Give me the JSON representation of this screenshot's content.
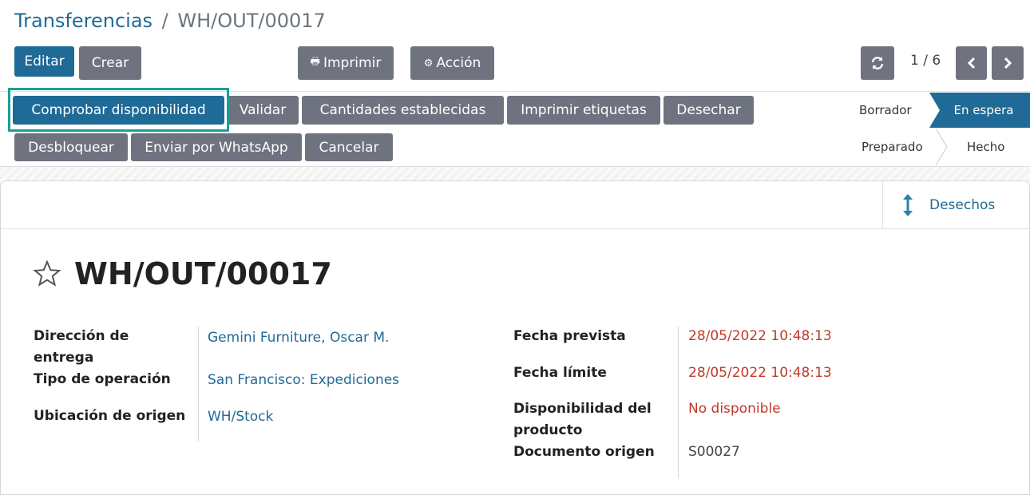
{
  "breadcrumb": {
    "parent": "Transferencias",
    "separator": "/",
    "current": "WH/OUT/00017"
  },
  "toolbar": {
    "edit_label": "Editar",
    "create_label": "Crear",
    "print_label": "Imprimir",
    "action_label": "Acción",
    "pager": "1 / 6"
  },
  "actions": {
    "check_availability": "Comprobar disponibilidad",
    "validate": "Validar",
    "set_quantities": "Cantidades establecidas",
    "print_labels": "Imprimir etiquetas",
    "scrap": "Desechar",
    "unlock": "Desbloquear",
    "whatsapp": "Enviar por WhatsApp",
    "cancel": "Cancelar"
  },
  "statusbar": {
    "draft": "Borrador",
    "waiting": "En espera",
    "ready": "Preparado",
    "done": "Hecho",
    "active": "En espera"
  },
  "smart_button": {
    "scraps_label": "Desechos"
  },
  "record": {
    "name": "WH/OUT/00017",
    "fields_left": [
      {
        "label": "Dirección de entrega",
        "value": "Gemini Furniture, Oscar M."
      },
      {
        "label": "Tipo de operación",
        "value": "San Francisco: Expediciones"
      },
      {
        "label": "Ubicación de origen",
        "value": "WH/Stock"
      }
    ],
    "fields_right": [
      {
        "label": "Fecha prevista",
        "value": "28/05/2022 10:48:13"
      },
      {
        "label": "Fecha límite",
        "value": "28/05/2022 10:48:13"
      },
      {
        "label": "Disponibilidad del producto",
        "value": "No disponible"
      },
      {
        "label": "Documento origen",
        "value": "S00027"
      }
    ]
  },
  "colors": {
    "primary": "#1f6a96",
    "secondary": "#6f7380",
    "highlight": "#16a09a",
    "danger": "#c0392b"
  },
  "icons": [
    "print-icon",
    "gear-icon",
    "refresh-icon",
    "chevron-left-icon",
    "chevron-right-icon",
    "star-icon",
    "vertical-arrows-icon"
  ]
}
